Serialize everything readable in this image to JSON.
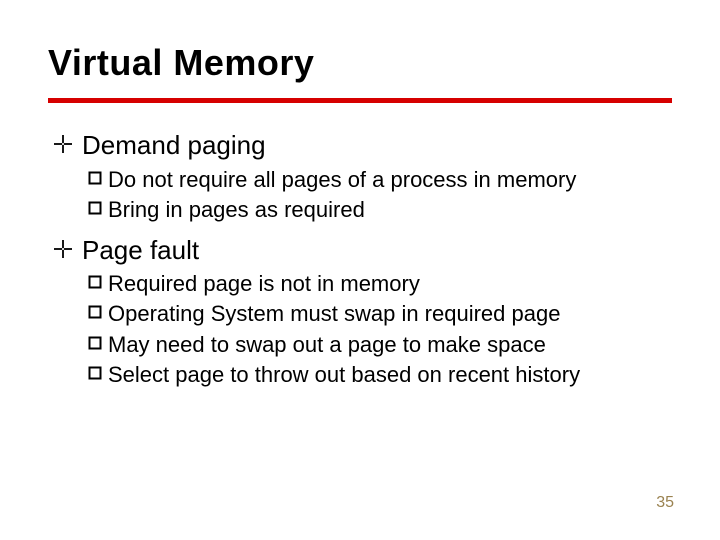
{
  "title": "Virtual Memory",
  "bullets": [
    {
      "label": "Demand paging",
      "sub": [
        "Do not require all pages of a process in memory",
        "Bring in pages as required"
      ]
    },
    {
      "label": "Page fault",
      "sub": [
        "Required page is not in memory",
        "Operating System must swap in required page",
        "May need to swap out a page to make space",
        "Select page to throw out based on recent history"
      ]
    }
  ],
  "page_number": "35"
}
